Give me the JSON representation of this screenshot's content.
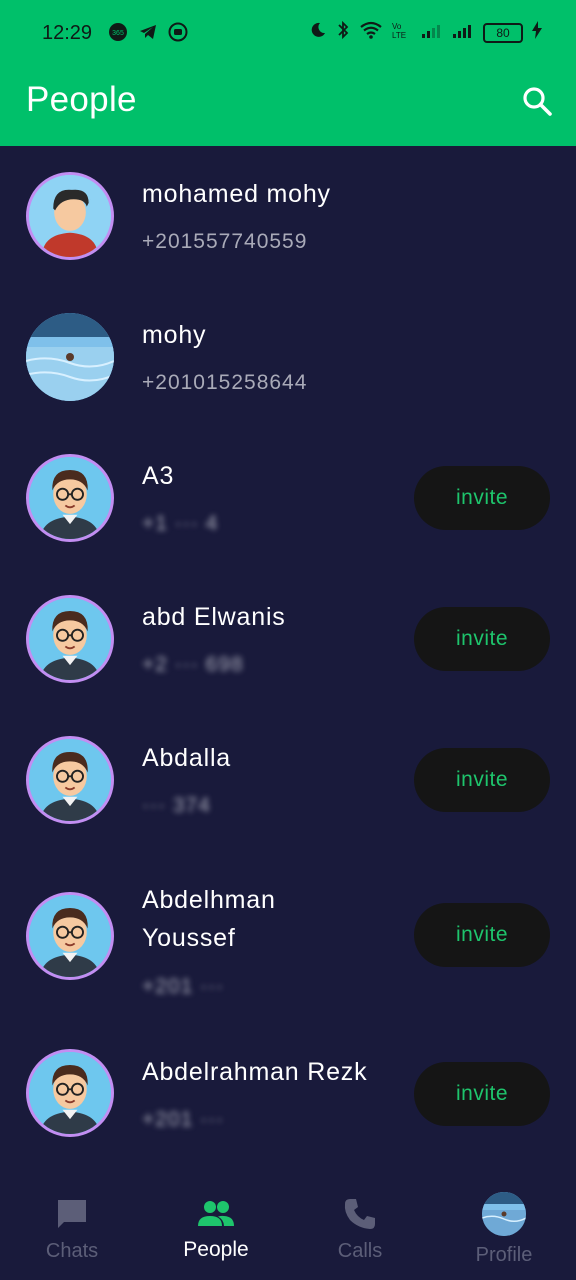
{
  "status_bar": {
    "time": "12:29",
    "battery": "80",
    "left_icons": [
      "365-icon",
      "telegram-icon",
      "app-icon"
    ],
    "right_icons": [
      "moon-icon",
      "bluetooth-icon",
      "wifi-icon",
      "volte-icon",
      "signal-icon",
      "signal-icon",
      "battery-icon",
      "charging-icon"
    ]
  },
  "header": {
    "title": "People",
    "search_icon": "search-icon",
    "accent_color": "#00c06a"
  },
  "contacts": [
    {
      "name": "mohamed mohy",
      "phone": "+201557740559",
      "avatar": "user-avatar",
      "invite": false
    },
    {
      "name": "mohy",
      "phone": "+201015258644",
      "avatar": "photo-avatar",
      "invite": false
    },
    {
      "name": "A3",
      "phone": "+1 ··· 4",
      "avatar": "default-avatar",
      "invite": true
    },
    {
      "name": "abd Elwanis",
      "phone": "+2 ··· 698",
      "avatar": "default-avatar",
      "invite": true
    },
    {
      "name": "Abdalla",
      "phone": "··· 374",
      "avatar": "default-avatar",
      "invite": true
    },
    {
      "name": "Abdelhman Youssef",
      "phone": "+201 ···",
      "avatar": "default-avatar",
      "invite": true
    },
    {
      "name": "Abdelrahman Rezk",
      "phone": "+201 ···",
      "avatar": "default-avatar",
      "invite": true
    }
  ],
  "invite_label": "invite",
  "nav": {
    "items": [
      {
        "label": "Chats",
        "icon": "chat-icon"
      },
      {
        "label": "People",
        "icon": "people-icon"
      },
      {
        "label": "Calls",
        "icon": "phone-icon"
      },
      {
        "label": "Profile",
        "icon": "profile-avatar"
      }
    ],
    "active": "People"
  }
}
